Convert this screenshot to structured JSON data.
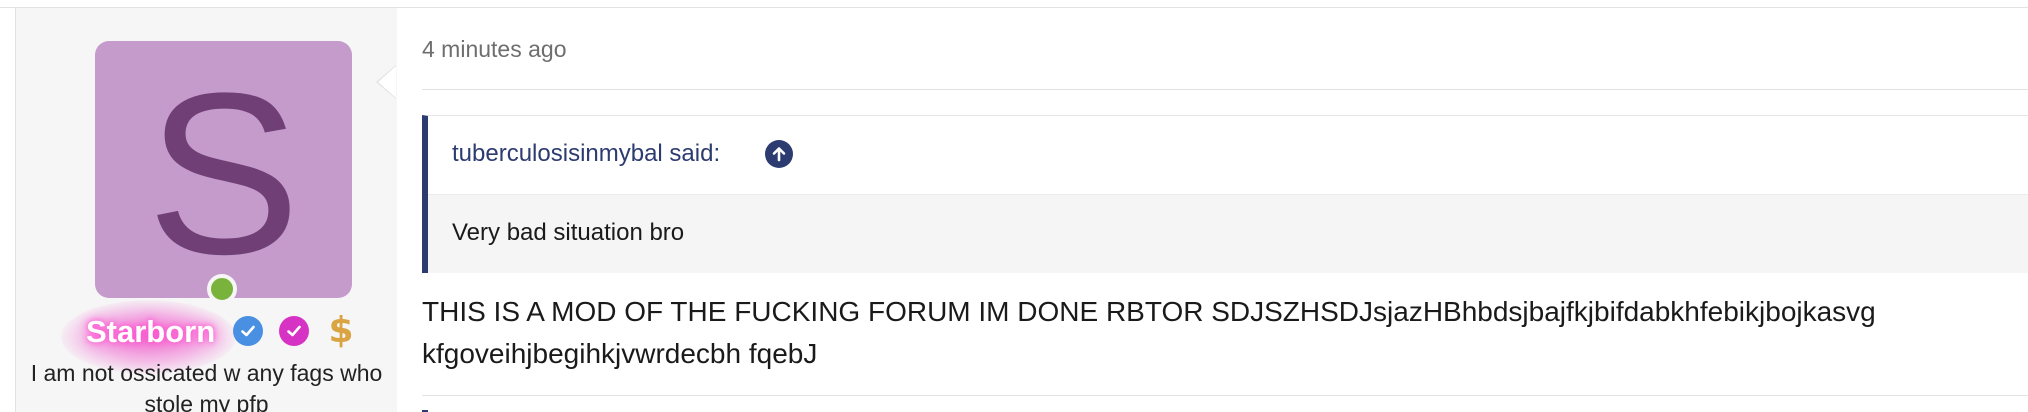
{
  "post": {
    "timestamp": "4 minutes ago",
    "quote": {
      "author_line": "tuberculosisinmybal said:",
      "text": "Very bad situation bro"
    },
    "body": "THIS IS A MOD OF THE FUCKING FORUM IM DONE RBTOR SDJSZHSDJsjazHBhbdsjbajfkjbifdabkhfebikjbojkasvg kfgoveihjbegihkjvwrdecbh fqebJ"
  },
  "user": {
    "avatar_letter": "S",
    "username": "Starborn",
    "title": "I am not ossicated w any fags who stole my pfp",
    "badges": [
      "verified-icon",
      "check-badge-icon",
      "dollar-icon"
    ],
    "online": true
  },
  "colors": {
    "avatar_bg": "#c49bcb",
    "avatar_letter": "#703f76",
    "quote_accent": "#2c3b70",
    "online": "#7ab33b",
    "username_glow": "#ff4fd0"
  }
}
